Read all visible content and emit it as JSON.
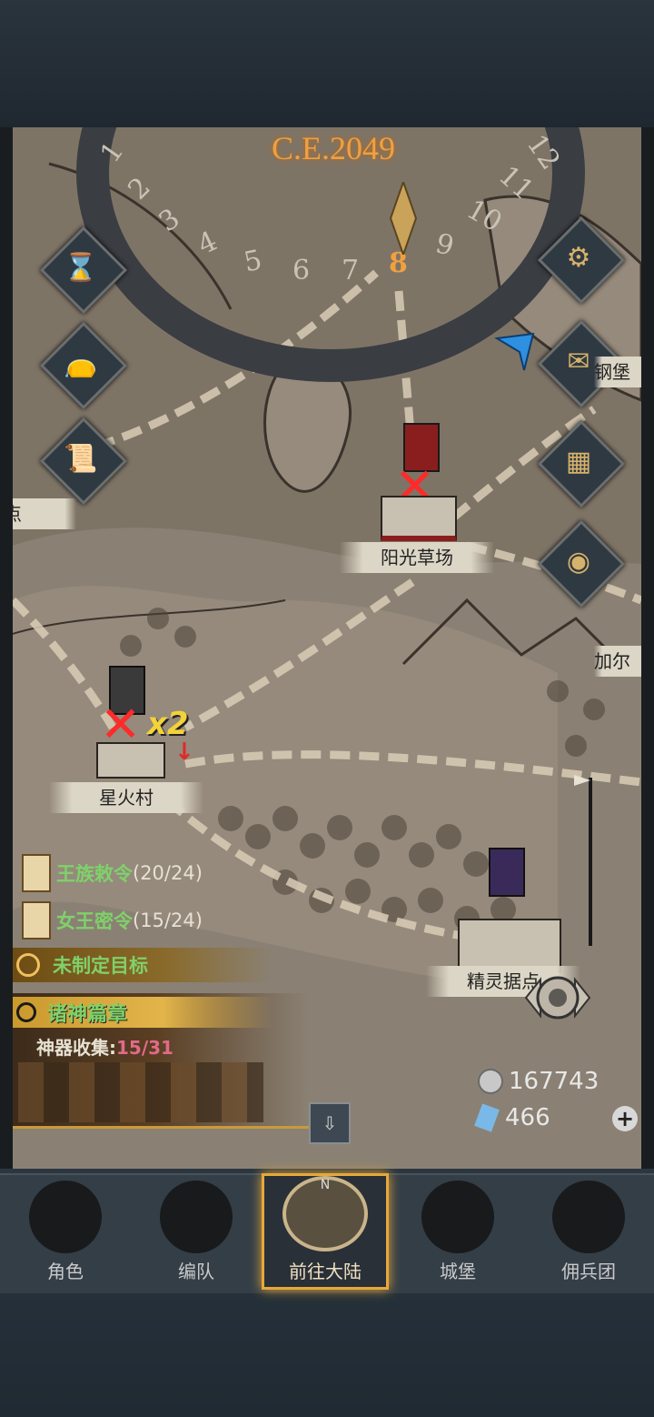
{
  "calendar": {
    "year": "C.E.2049",
    "months": [
      "1",
      "2",
      "3",
      "4",
      "5",
      "6",
      "7",
      "8",
      "9",
      "10",
      "11",
      "12"
    ],
    "current_month": "8"
  },
  "side_buttons": [
    {
      "name": "hourglass-icon"
    },
    {
      "name": "bag-icon"
    },
    {
      "name": "scroll-icon"
    }
  ],
  "right_buttons": [
    {
      "name": "gear-icon"
    },
    {
      "name": "mail-icon"
    },
    {
      "name": "board-icon"
    },
    {
      "name": "coin-icon"
    }
  ],
  "locations": {
    "sunny_meadow": "阳光草场",
    "starfire_village": "星火村",
    "elf_outpost": "精灵据点",
    "left_edge": "点",
    "right_edge_top": "钢堡",
    "right_edge_mid": "加尔"
  },
  "battle_multiplier": "x2",
  "quests": [
    {
      "title": "王族敕令",
      "progress": "(20/24)"
    },
    {
      "title": "女王密令",
      "progress": "(15/24)"
    },
    {
      "title": "未制定目标",
      "progress": ""
    }
  ],
  "gods_chapter": {
    "title": "诸神篇章",
    "artifact_label": "神器收集:",
    "artifact_progress": "15/31"
  },
  "resources": {
    "silver": "167743",
    "crystal": "466"
  },
  "tabs": [
    {
      "label": "角色"
    },
    {
      "label": "编队"
    },
    {
      "label": "前往大陆"
    },
    {
      "label": "城堡"
    },
    {
      "label": "佣兵团"
    }
  ],
  "compass_letter": "N",
  "colors": {
    "accent_gold": "#f0a040",
    "quest_green": "#7fd16a",
    "progress_pink": "#e06a8a",
    "map_paper": "#7e7466"
  }
}
